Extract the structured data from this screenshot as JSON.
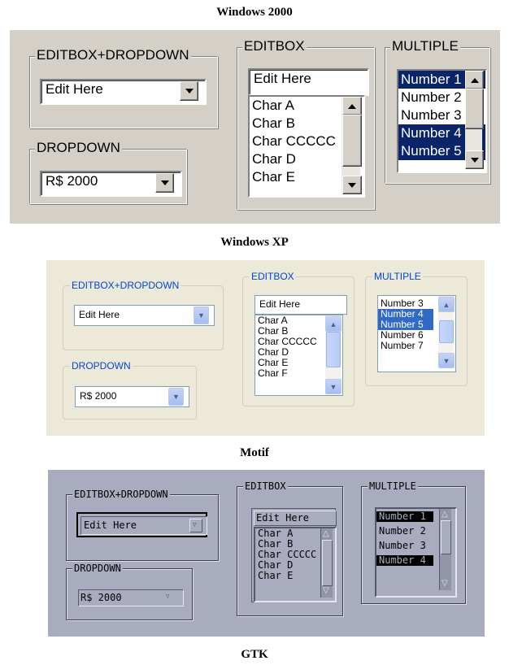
{
  "captions": {
    "w2k": "Windows 2000",
    "xp": "Windows XP",
    "motif": "Motif",
    "gtk": "GTK"
  },
  "labels": {
    "editbox_dropdown": "EDITBOX+DROPDOWN",
    "dropdown": "DROPDOWN",
    "editbox": "EDITBOX",
    "multiple": "MULTIPLE"
  },
  "values": {
    "edit_text": "Edit Here",
    "dropdown_value": "R$ 2000"
  },
  "w2k": {
    "editbox_items": [
      "Char A",
      "Char B",
      "Char CCCCC",
      "Char D",
      "Char E"
    ],
    "multiple_items": [
      {
        "text": "Number 1",
        "selected": true
      },
      {
        "text": "Number 2",
        "selected": false
      },
      {
        "text": "Number 3",
        "selected": false
      },
      {
        "text": "Number 4",
        "selected": true
      },
      {
        "text": "Number 5",
        "selected": true
      }
    ]
  },
  "xp": {
    "editbox_items": [
      "Char A",
      "Char B",
      "Char CCCCC",
      "Char D",
      "Char E",
      "Char F"
    ],
    "multiple_items": [
      {
        "text": "Number 3",
        "selected": false
      },
      {
        "text": "Number 4",
        "selected": true
      },
      {
        "text": "Number 5",
        "selected": true
      },
      {
        "text": "Number 6",
        "selected": false
      },
      {
        "text": "Number 7",
        "selected": false
      }
    ]
  },
  "motif": {
    "editbox_items": [
      "Char A",
      "Char B",
      "Char CCCCC",
      "Char D",
      "Char E"
    ],
    "multiple_items": [
      {
        "text": "Number 1",
        "selected": true
      },
      {
        "text": "Number 2",
        "selected": false
      },
      {
        "text": "Number 3",
        "selected": false
      },
      {
        "text": "Number 4",
        "selected": true
      }
    ]
  },
  "colors": {
    "w2k_face": "#d4d0c8",
    "w2k_selection": "#0a246a",
    "xp_face": "#ece9d8",
    "xp_selection": "#316ac5",
    "xp_legend": "#0046d5",
    "motif_face": "#a9abbf"
  },
  "icons": {
    "dropdown_arrow": "chevron-down-icon",
    "scroll_up": "arrow-up-icon",
    "scroll_down": "arrow-down-icon"
  }
}
